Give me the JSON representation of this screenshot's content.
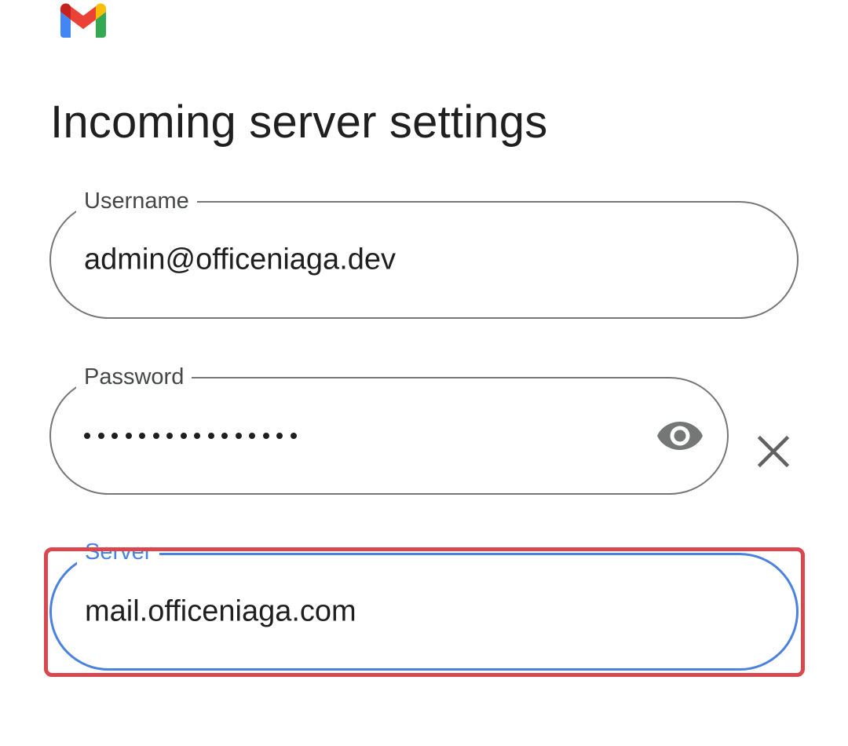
{
  "app": {
    "logo_icon": "gmail-logo-icon"
  },
  "page": {
    "title": "Incoming server settings"
  },
  "fields": {
    "username": {
      "label": "Username",
      "value": "admin@officeniaga.dev"
    },
    "password": {
      "label": "Password",
      "masked_length": 16,
      "toggle_icon": "eye-icon",
      "clear_icon": "close-icon"
    },
    "server": {
      "label": "Server",
      "value": "mail.officeniaga.com",
      "focused": true
    }
  },
  "colors": {
    "focus_blue": "#4b82e0",
    "outline_gray": "#747775",
    "highlight_red": "#d9484f",
    "text_dark": "#1f1f1f"
  }
}
